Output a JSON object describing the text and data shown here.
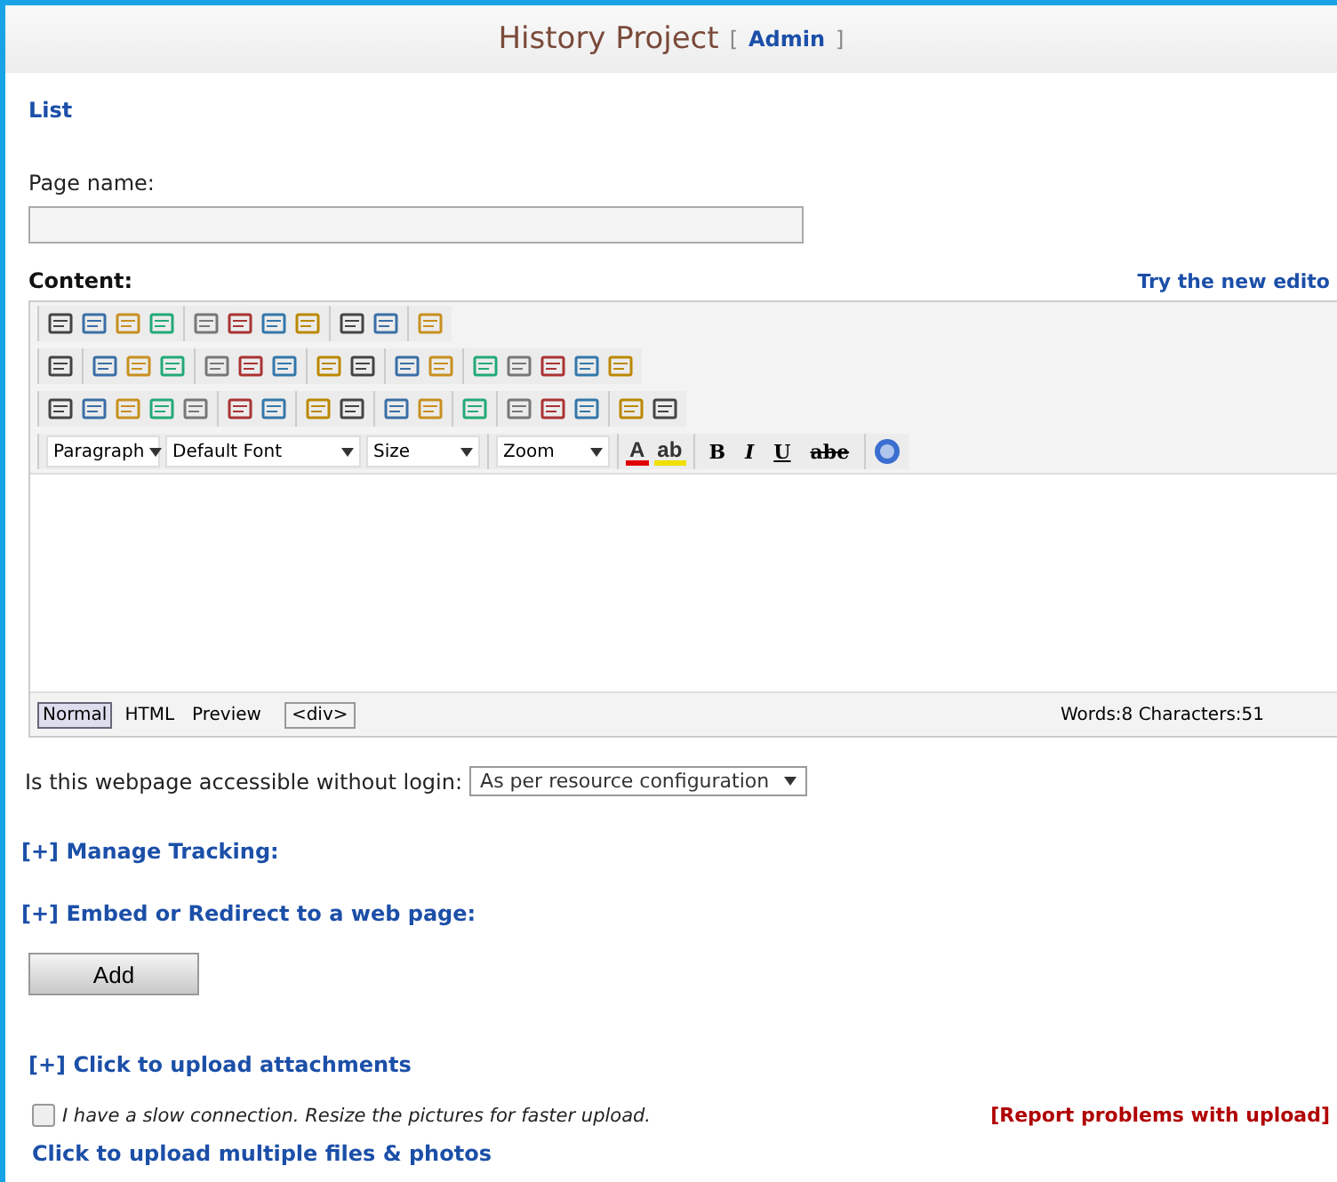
{
  "header": {
    "title": "History Project",
    "admin_link": "Admin",
    "bracket_open": "[",
    "bracket_close": "]"
  },
  "list_link": "List",
  "page_name": {
    "label": "Page name:"
  },
  "content": {
    "label": "Content:",
    "new_editor_link": "Try the new edito"
  },
  "editor": {
    "dropdowns": [
      {
        "label": "Paragraph",
        "kind": "short"
      },
      {
        "label": "Default Font",
        "kind": "wide"
      },
      {
        "label": "Size",
        "kind": "short"
      },
      {
        "label": "Zoom",
        "kind": "short"
      }
    ],
    "color_buttons": [
      {
        "label": "A",
        "color": "#e00000"
      },
      {
        "label": "ab",
        "color": "#f0e000"
      }
    ],
    "format_buttons": [
      {
        "label": "B",
        "kind": "bold"
      },
      {
        "label": "I",
        "kind": "italic"
      },
      {
        "label": "U",
        "kind": "underline"
      },
      {
        "label": "abe",
        "kind": "strike"
      }
    ],
    "modes": [
      {
        "label": "Normal",
        "selected": true
      },
      {
        "label": "HTML",
        "selected": false
      },
      {
        "label": "Preview",
        "selected": false
      }
    ],
    "tag_path": "<div>",
    "counts": "Words:8 Characters:51"
  },
  "access": {
    "label": "Is this webpage accessible without login:",
    "value": "As per resource configuration"
  },
  "sections": [
    {
      "marker": "[+]",
      "label": "Manage Tracking:"
    },
    {
      "marker": "[+]",
      "label": "Embed or Redirect to a web page:"
    }
  ],
  "add_button": "Add",
  "attachments": {
    "marker": "[+]",
    "label": "Click to upload attachments"
  },
  "slow_connection": {
    "label": "I have a slow connection. Resize the pictures for faster upload.",
    "checked": false
  },
  "report_link": "[Report problems with upload]",
  "multi_upload_link": "Click to upload multiple files & photos"
}
